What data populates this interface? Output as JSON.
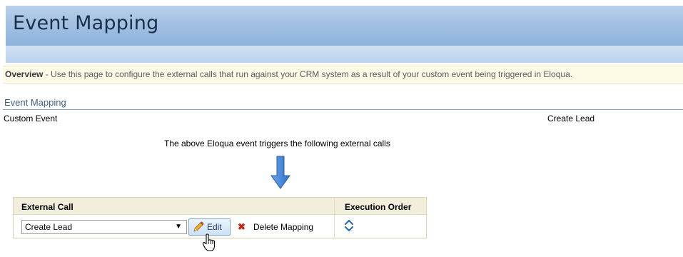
{
  "header": {
    "title": "Event Mapping"
  },
  "overview": {
    "label": "Overview",
    "text": " -  Use this page to configure the external calls that run against your CRM system as a result of your custom event being triggered in Eloqua."
  },
  "section": {
    "title": "Event Mapping",
    "custom_event_label": "Custom Event",
    "custom_event_value": "Create Lead",
    "triggers_text": "The above Eloqua event triggers the following external calls"
  },
  "table": {
    "headers": {
      "external_call": "External Call",
      "execution_order": "Execution Order"
    },
    "rows": [
      {
        "external_call": "Create Lead",
        "edit_label": "Edit",
        "delete_label": "Delete Mapping"
      }
    ]
  },
  "icons": {
    "arrow": "down-arrow-icon",
    "pencil": "pencil-icon",
    "delete": "delete-x-icon",
    "order": "sort-order-icon",
    "cursor": "hand-cursor-icon"
  },
  "colors": {
    "header_blue": "#a2c0e2",
    "overview_bg": "#fdfbe6",
    "table_head_bg": "#f2eedc",
    "delete_red": "#c8261b",
    "arrow_blue": "#4b8fe0"
  }
}
